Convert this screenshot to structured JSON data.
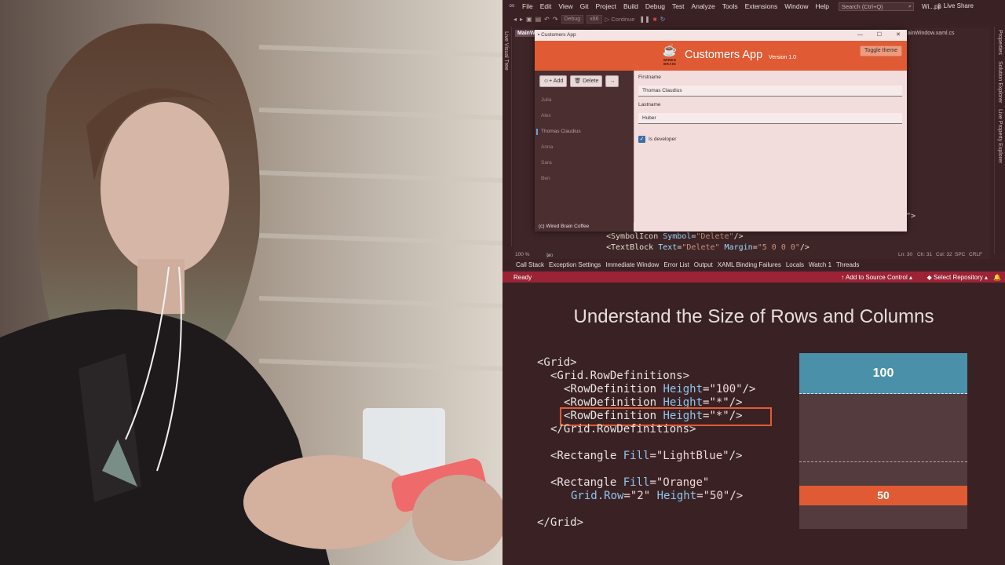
{
  "vs": {
    "menu": [
      "File",
      "Edit",
      "View",
      "Git",
      "Project",
      "Build",
      "Debug",
      "Test",
      "Analyze",
      "Tools",
      "Extensions",
      "Window",
      "Help"
    ],
    "search_placeholder": "Search (Ctrl+Q)",
    "window_title": "Wi...pp",
    "live_share": "Live Share",
    "toolbar": {
      "config": "Debug",
      "platform": "x86",
      "continue": "Continue"
    },
    "left_panel": "Live Visual Tree",
    "right_panels": [
      "Properties",
      "Solution Explorer",
      "Live Property Explorer"
    ],
    "editor_tab": "MainW",
    "editor_tab2": "ainWindow.xaml.cs",
    "code_frag": "\">",
    "code_lines": [
      {
        "tag": "<SymbolIcon ",
        "attr": "Symbol",
        "eq": "=",
        "val": "\"Delete\"",
        "end": "/>"
      },
      {
        "tag": "<TextBlock ",
        "attr": "Text",
        "eq": "=",
        "val": "\"Delete\"",
        "attr2": " Margin",
        "eq2": "=",
        "val2": "\"5 0 0 0\"",
        "end": "/>"
      }
    ],
    "editor_status": {
      "zoom": "100 %",
      "issues": "No issues found",
      "ln": "Ln: 30",
      "ch": "Ch: 31",
      "col": "Col: 32",
      "spc": "SPC",
      "crlf": "CRLF"
    },
    "tool_windows": [
      "Call Stack",
      "Exception Settings",
      "Immediate Window",
      "Error List",
      "Output",
      "XAML Binding Failures",
      "Locals",
      "Watch 1",
      "Threads"
    ],
    "status": {
      "ready": "Ready",
      "source_control": "Add to Source Control",
      "repo": "Select Repository"
    }
  },
  "app": {
    "window_title": "Customers App",
    "title": "Customers App",
    "version": "Version 1.0",
    "logo_text": "WIRED BRAIN",
    "toggle_theme": "Toggle theme",
    "add_label": "Add",
    "delete_label": "Delete",
    "customers": [
      "Julia",
      "Alex",
      "Thomas Claudius",
      "Anna",
      "Sara",
      "Ben"
    ],
    "selected_index": 2,
    "firstname_label": "Firstname",
    "firstname_value": "Thomas Claudius",
    "lastname_label": "Lastname",
    "lastname_value": "Huber",
    "is_developer_label": "Is developer",
    "is_developer": true,
    "footer": "(c) Wired Brain Coffee"
  },
  "slide": {
    "title": "Understand the Size of Rows and Columns",
    "code": {
      "grid_open": "<Grid>",
      "rowdefs_open": "<Grid.RowDefinitions>",
      "rows": [
        {
          "tag": "<RowDefinition ",
          "attr": "Height",
          "val": "=\"100\"",
          "end": "/>"
        },
        {
          "tag": "<RowDefinition ",
          "attr": "Height",
          "val": "=\"*\"",
          "end": "/>"
        },
        {
          "tag": "<RowDefinition ",
          "attr": "Height",
          "val": "=\"*\"",
          "end": "/>"
        }
      ],
      "rowdefs_close": "</Grid.RowDefinitions>",
      "rect1": {
        "tag": "<Rectangle ",
        "attr": "Fill",
        "val": "=\"LightBlue\"",
        "end": "/>"
      },
      "rect2_line1": {
        "tag": "<Rectangle ",
        "attr": "Fill",
        "val": "=\"Orange\""
      },
      "rect2_line2": {
        "attr": "Grid.Row",
        "val": "=\"2\"",
        "attr2": " Height",
        "val2": "=\"50\"",
        "end": "/>"
      },
      "grid_close": "</Grid>"
    },
    "diagram": {
      "top_row": "100",
      "bottom_rect": "50"
    },
    "colors": {
      "lightblue": "#4a90a8",
      "orange": "#e05b34",
      "highlight": "#e05b34",
      "status": "#9b2335"
    }
  }
}
